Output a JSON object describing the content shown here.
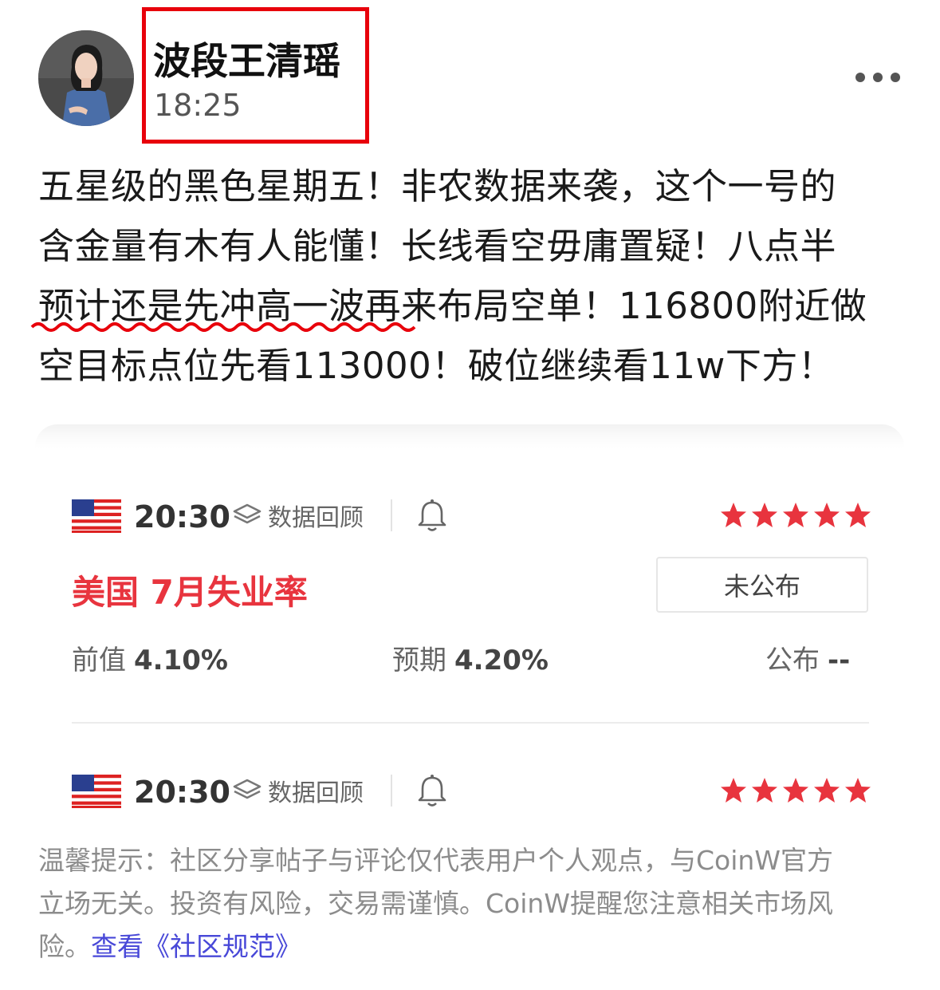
{
  "post": {
    "author": "波段王清瑶",
    "time": "18:25",
    "lines": [
      "五星级的黑色星期五！非农数据来袭，这个一号的",
      "含金量有木有人能懂！长线看空毋庸置疑！八点半",
      "预计还是先冲高一波再来布局空单！116800附近做",
      "空目标点位先看113000！破位继续看11w下方！"
    ]
  },
  "events": [
    {
      "time": "20:30",
      "review_label": "数据回顾",
      "stars": 5,
      "title": "美国 7月失业率",
      "status": "未公布",
      "previous_label": "前值",
      "previous_value": "4.10%",
      "forecast_label": "预期",
      "forecast_value": "4.20%",
      "actual_label": "公布",
      "actual_value": "--"
    },
    {
      "time": "20:30",
      "review_label": "数据回顾",
      "stars": 5
    }
  ],
  "disclaimer": {
    "line1": "温馨提示：社区分享帖子与评论仅代表用户个人观点，与CoinW官方",
    "line2": "立场无关。投资有风险，交易需谨慎。CoinW提醒您注意相关市场风",
    "line3_prefix": "险。",
    "link_text": "查看《社区规范》"
  },
  "icons": {
    "avatar": "avatar-photo",
    "more": "more-dots-icon",
    "flag": "us-flag-icon",
    "review": "layers-icon",
    "bell": "bell-icon",
    "star": "star-icon"
  },
  "colors": {
    "highlight_box": "#e8000b",
    "event_title": "#e8343e",
    "star": "#e8343e",
    "link": "#4848d8",
    "squiggle": "#e8000b"
  }
}
